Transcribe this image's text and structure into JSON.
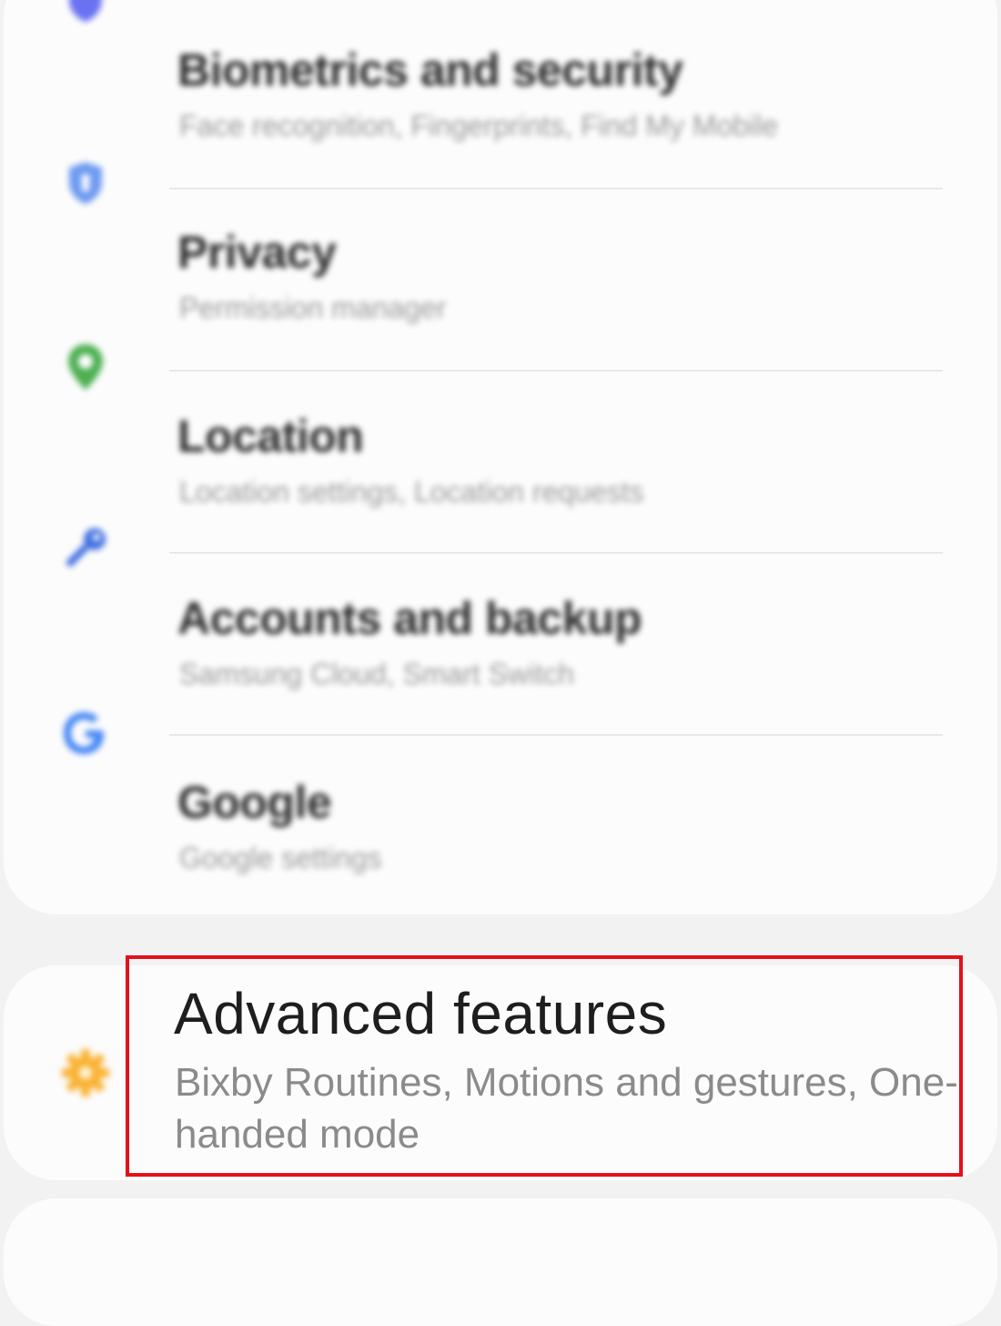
{
  "settings_list": {
    "items": [
      {
        "title": "Biometrics and security",
        "subtitle": "Face recognition, Fingerprints, Find My Mobile",
        "icon": "shield-icon",
        "icon_color": "#6b72f2"
      },
      {
        "title": "Privacy",
        "subtitle": "Permission manager",
        "icon": "privacy-shield-icon",
        "icon_color": "#6d9af0"
      },
      {
        "title": "Location",
        "subtitle": "Location settings, Location requests",
        "icon": "location-pin-icon",
        "icon_color": "#4caf50"
      },
      {
        "title": "Accounts and backup",
        "subtitle": "Samsung Cloud, Smart Switch",
        "icon": "key-icon",
        "icon_color": "#3f6fe0"
      },
      {
        "title": "Google",
        "subtitle": "Google settings",
        "icon": "google-g-icon",
        "icon_color": "#4285f4"
      }
    ]
  },
  "advanced_features": {
    "title": "Advanced features",
    "subtitle": "Bixby Routines, Motions and gestures, One-handed mode",
    "icon": "gear-icon",
    "icon_color": "#f9b233"
  },
  "highlight": {
    "color": "#e4101c"
  }
}
